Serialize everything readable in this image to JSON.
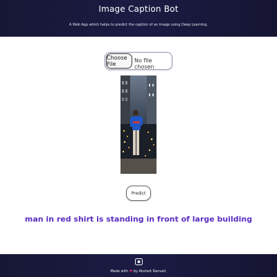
{
  "header": {
    "title": "Image Caption Bot",
    "subtitle": "A Web App which helps to predict the caption of an image using Deep Learning."
  },
  "upload": {
    "choose_label": "Choose File",
    "no_file_text": "No file chosen"
  },
  "predict_label": "Predict",
  "caption": "man in red shirt is standing in front of large building",
  "footer": {
    "made_with": "Made with",
    "heart_icon": "heart-icon",
    "by": "by Aksheit Ranveil."
  },
  "colors": {
    "header_bg": "#1b1b44",
    "caption_color": "#5a2ec0",
    "heart_color": "#e0245e"
  }
}
